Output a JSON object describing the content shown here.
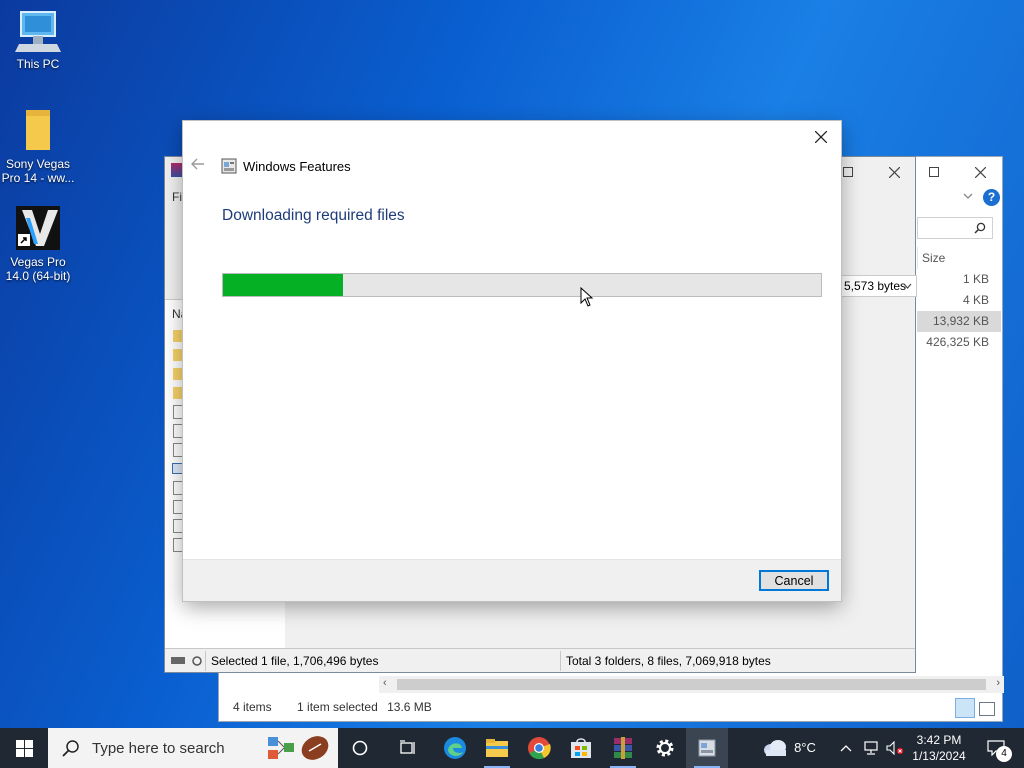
{
  "desktop": {
    "icons": [
      {
        "label": "This PC"
      },
      {
        "label": "Sony Vegas Pro 14 - ww..."
      },
      {
        "label": "Vegas Pro 14.0 (64-bit)"
      }
    ]
  },
  "explorer": {
    "size_header": "Size",
    "sizes": [
      "1 KB",
      "4 KB",
      "13,932 KB",
      "426,325 KB"
    ],
    "status_items": "4 items",
    "status_selected": "1 item selected",
    "status_size": "13.6 MB"
  },
  "rar": {
    "menu_first": "Fil",
    "col_first": "Na",
    "bytes_dropdown": "5,573 bytes",
    "status_selected": "Selected 1 file, 1,706,496 bytes",
    "status_total": "Total 3 folders, 8 files, 7,069,918 bytes"
  },
  "dialog": {
    "title": "Windows Features",
    "heading": "Downloading required files",
    "progress": 0.2,
    "cancel_label": "Cancel"
  },
  "taskbar": {
    "search_placeholder": "Type here to search",
    "weather_temp": "8°C",
    "time": "3:42 PM",
    "date": "1/13/2024",
    "notification_count": "4"
  },
  "colors": {
    "progress_fill": "#06b025",
    "heading": "#1e3c7a",
    "accent": "#0078d7"
  }
}
